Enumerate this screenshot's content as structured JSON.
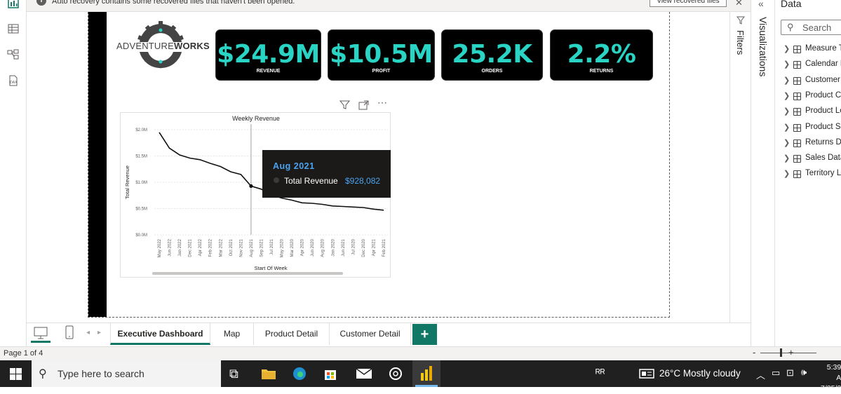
{
  "notification": {
    "message": "Auto recovery contains some recovered files that haven't been opened.",
    "button": "View recovered files",
    "close": "✕"
  },
  "logo": {
    "text_light": "ADVENTURE",
    "text_bold": "WORKS"
  },
  "kpis": [
    {
      "value": "$24.9M",
      "label": "REVENUE"
    },
    {
      "value": "$10.5M",
      "label": "PROFIT"
    },
    {
      "value": "25.2K",
      "label": "ORDERS"
    },
    {
      "value": "2.2%",
      "label": "RETURNS"
    }
  ],
  "chart_data": {
    "type": "line",
    "title": "Weekly Revenue",
    "xlabel": "Start Of Week",
    "ylabel": "Total Revenue",
    "ylim": [
      0,
      2000000
    ],
    "yticks": [
      "$0.0M",
      "$0.5M",
      "$1.0M",
      "$1.5M",
      "$2.0M"
    ],
    "categories": [
      "May 2022",
      "Jun 2022",
      "Jan 2022",
      "Dec 2021",
      "Apr 2022",
      "Feb 2022",
      "Mar 2022",
      "Oct 2021",
      "Nov 2021",
      "Aug 2021",
      "Sep 2021",
      "Jul 2021",
      "May 2020",
      "Mar 2020",
      "Apr 2020",
      "Jun 2020",
      "Aug 2020",
      "Jan 2020",
      "Jun 2021",
      "Jul 2020",
      "Dec 2020",
      "Apr 2021",
      "Feb 2021"
    ],
    "series": [
      {
        "values": [
          1950000,
          1650000,
          1520000,
          1460000,
          1430000,
          1360000,
          1300000,
          1200000,
          1150000,
          928082,
          870000,
          760000,
          700000,
          660000,
          610000,
          600000,
          580000,
          550000,
          540000,
          530000,
          520000,
          490000,
          470000
        ]
      }
    ],
    "tooltip": {
      "category": "Aug 2021",
      "series": "Total Revenue",
      "value": "$928,082"
    }
  },
  "filters_label": "Filters",
  "visualizations_label": "Visualizations",
  "data_pane": {
    "title": "Data",
    "search_placeholder": "Search",
    "fields": [
      "Measure Ta",
      "Calendar L",
      "Customer",
      "Product Ca",
      "Product Lo",
      "Product Su",
      "Returns Da",
      "Sales Data",
      "Territory Lo"
    ]
  },
  "tabs": [
    "Executive Dashboard",
    "Map",
    "Product Detail",
    "Customer Detail"
  ],
  "add_tab": "+",
  "status": {
    "page": "Page 1 of 4",
    "zoom_minus": "-",
    "zoom_plus": "+"
  },
  "taskbar": {
    "search_placeholder": "Type here to search",
    "weather": "26°C  Mostly cloudy",
    "time": "5:39 A",
    "date": "7/25/2"
  }
}
